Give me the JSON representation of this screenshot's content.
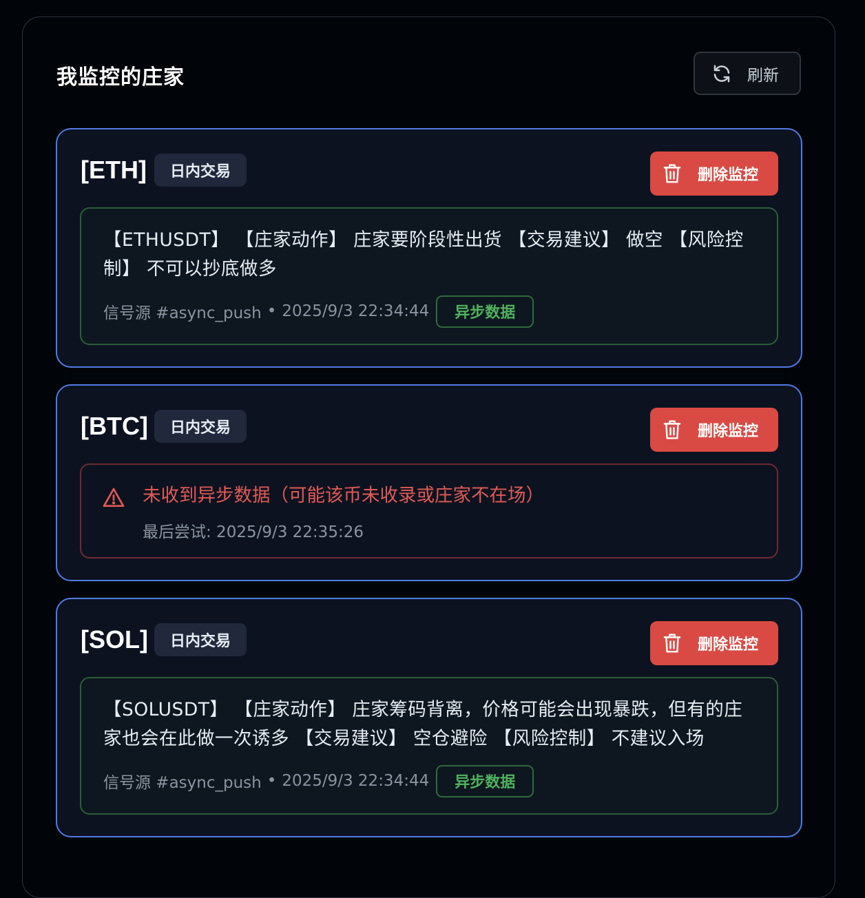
{
  "panel": {
    "title": "我监控的庄家",
    "refresh_label": "刷新"
  },
  "monitors": [
    {
      "symbol": "[ETH]",
      "tag": "日内交易",
      "delete_label": "删除监控",
      "signal_text": "【ETHUSDT】 【庄家动作】 庄家要阶段性出货 【交易建议】 做空 【风险控制】 不可以抄底做多",
      "source": "信号源 #async_push",
      "separator": "•",
      "time": "2025/9/3 22:34:44",
      "badge": "异步数据"
    },
    {
      "symbol": "[BTC]",
      "tag": "日内交易",
      "delete_label": "删除监控",
      "error_text": "未收到异步数据（可能该币未收录或庄家不在场）",
      "last_try": "最后尝试: 2025/9/3 22:35:26"
    },
    {
      "symbol": "[SOL]",
      "tag": "日内交易",
      "delete_label": "删除监控",
      "signal_text": "【SOLUSDT】 【庄家动作】 庄家筹码背离，价格可能会出现暴跌，但有的庄家也会在此做一次诱多 【交易建议】 空仓避险 【风险控制】 不建议入场",
      "source": "信号源 #async_push",
      "separator": "•",
      "time": "2025/9/3 22:34:44",
      "badge": "异步数据"
    }
  ],
  "icons": {
    "refresh": "refresh-icon",
    "delete": "trash-icon",
    "warning": "warning-triangle-icon"
  },
  "colors": {
    "background": "#010409",
    "card_border": "#4f7ce3",
    "delete_button": "#da4a44",
    "success_green": "#4fb15d",
    "error_red": "#e05a54"
  }
}
